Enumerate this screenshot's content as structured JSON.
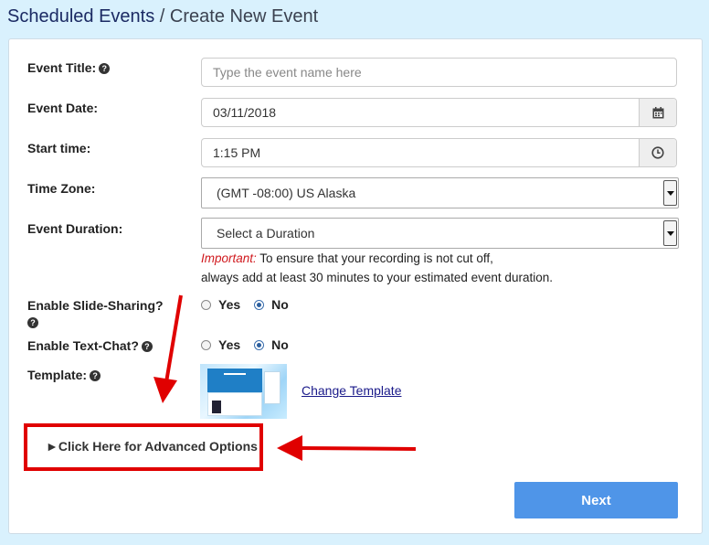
{
  "breadcrumb": {
    "parent": "Scheduled Events",
    "separator": " / ",
    "current": "Create New Event"
  },
  "form": {
    "title": {
      "label": "Event Title:",
      "placeholder": "Type the event name here"
    },
    "date": {
      "label": "Event Date:",
      "value": "03/11/2018",
      "icon": "calendar-icon"
    },
    "start_time": {
      "label": "Start time:",
      "value": "1:15 PM",
      "icon": "clock-icon"
    },
    "time_zone": {
      "label": "Time Zone:",
      "value": "(GMT -08:00) US Alaska"
    },
    "duration": {
      "label": "Event Duration:",
      "value": "Select a Duration",
      "note_important": "Important:",
      "note_line1": " To ensure that your recording is not cut off,",
      "note_line2": "always add at least 30 minutes to your estimated event duration."
    },
    "slide_sharing": {
      "label": "Enable Slide-Sharing?",
      "yes": "Yes",
      "no": "No",
      "selected": "No"
    },
    "text_chat": {
      "label": "Enable Text-Chat?",
      "yes": "Yes",
      "no": "No",
      "selected": "No"
    },
    "template": {
      "label": "Template:",
      "change_link": "Change Template"
    },
    "help_icon": "?",
    "advanced_toggle": "►Click Here for Advanced Options",
    "next_button": "Next"
  },
  "colors": {
    "background": "#d9f1fd",
    "breadcrumb": "#1b2a63",
    "important": "#d0191e",
    "annotation": "#e00000",
    "next_button": "#4f95e8"
  }
}
